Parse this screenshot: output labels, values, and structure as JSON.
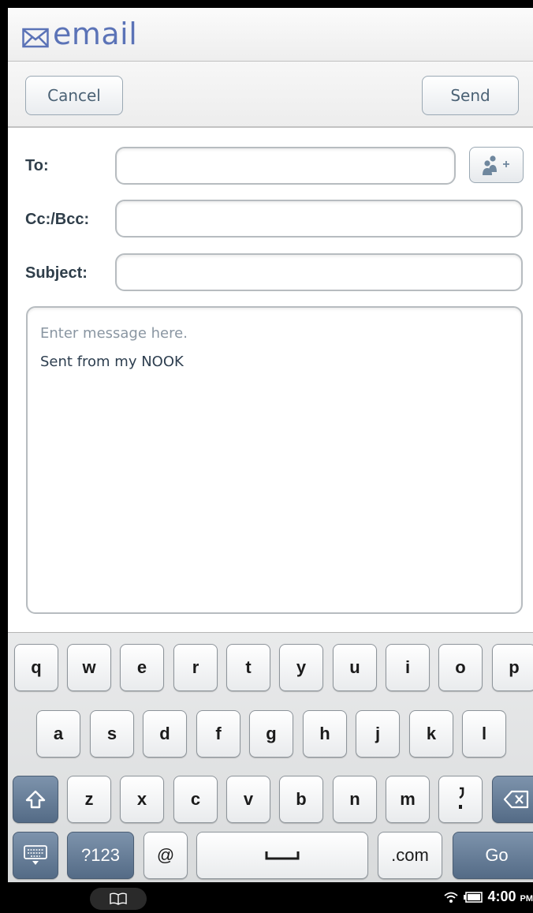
{
  "app": {
    "title": "email",
    "cancel_label": "Cancel",
    "send_label": "Send"
  },
  "fields": {
    "to_label": "To:",
    "to_value": "",
    "cc_label": "Cc:/Bcc:",
    "cc_value": "",
    "subject_label": "Subject:",
    "subject_value": ""
  },
  "message": {
    "placeholder": "Enter message here.",
    "signature": "Sent from my NOOK"
  },
  "keyboard": {
    "row1": [
      "q",
      "w",
      "e",
      "r",
      "t",
      "y",
      "u",
      "i",
      "o",
      "p"
    ],
    "row2": [
      "a",
      "s",
      "d",
      "f",
      "g",
      "h",
      "j",
      "k",
      "l"
    ],
    "row3": [
      "z",
      "x",
      "c",
      "v",
      "b",
      "n",
      "m"
    ],
    "symbols_label": "?123",
    "at_label": "@",
    "dotcom_label": ".com",
    "go_label": "Go"
  },
  "status_bar": {
    "time": "4:00",
    "ampm": "PM"
  },
  "icons": [
    "envelope-icon",
    "add-contact-icon",
    "shift-icon",
    "backspace-icon",
    "keyboard-hide-icon",
    "space-icon",
    "book-icon",
    "wifi-icon",
    "battery-icon"
  ],
  "colors": {
    "title_blue": "#5b73b7",
    "dark_key": "#546b86",
    "button_text": "#4b6275"
  }
}
